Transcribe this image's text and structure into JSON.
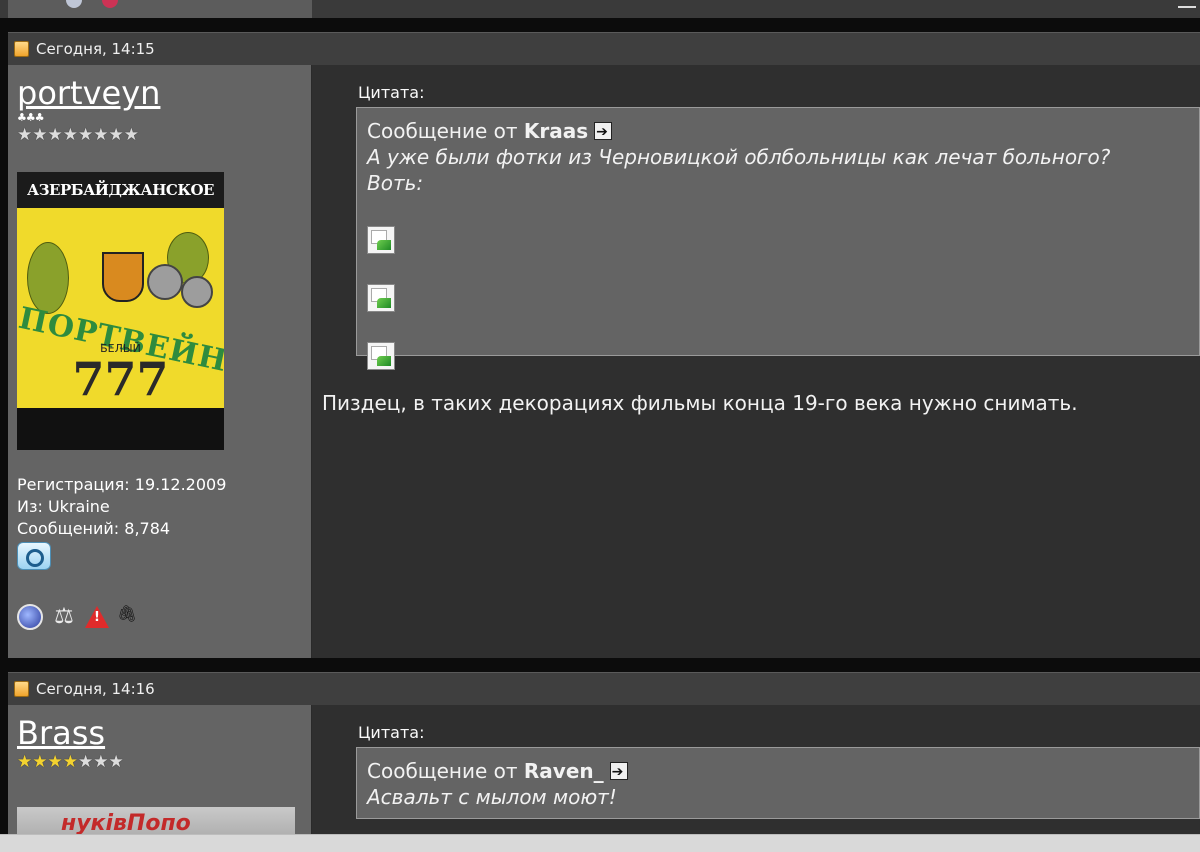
{
  "posts": [
    {
      "time": "Сегодня, 14:15",
      "user": {
        "name": "portveyn",
        "rank_pips": "♣♣♣",
        "stars_filled": 0,
        "stars_total": 8,
        "avatar_alt": "АЗЕРБАЙДЖАНСКОЕ ВИНО",
        "avatar_word": "ПОРТВЕЙН",
        "avatar_sub": "БЕЛЫЙ",
        "avatar_number": "777",
        "registration": "Регистрация: 19.12.2009",
        "from": "Из: Ukraine",
        "messages": "Сообщений: 8,784"
      },
      "quote": {
        "label": "Цитата:",
        "from_prefix": "Сообщение от",
        "from_user": "Kraas",
        "line1": "А уже были фотки из Черновицкой облбольницы как лечат больного?",
        "line2": "Воть:"
      },
      "text": "Пиздец, в таких декорациях фильмы конца 19-го века нужно снимать."
    },
    {
      "time": "Сегодня, 14:16",
      "user": {
        "name": "Brass",
        "stars_filled": 4,
        "stars_total": 7,
        "avatar_text": "нуківПопо"
      },
      "quote": {
        "label": "Цитата:",
        "from_prefix": "Сообщение от",
        "from_user": "Raven_",
        "line1": "Асвальт с мылом моют!"
      }
    }
  ],
  "icons": {
    "post_icon": "post-new-icon",
    "view_post": "view-post-arrow-icon",
    "gender": "gender-male-icon",
    "award_globe": "globe-award-icon",
    "award_scales": "scales-icon",
    "warning": "warning-icon",
    "attachment": "paperclip-icon",
    "broken_image": "broken-image-icon"
  }
}
